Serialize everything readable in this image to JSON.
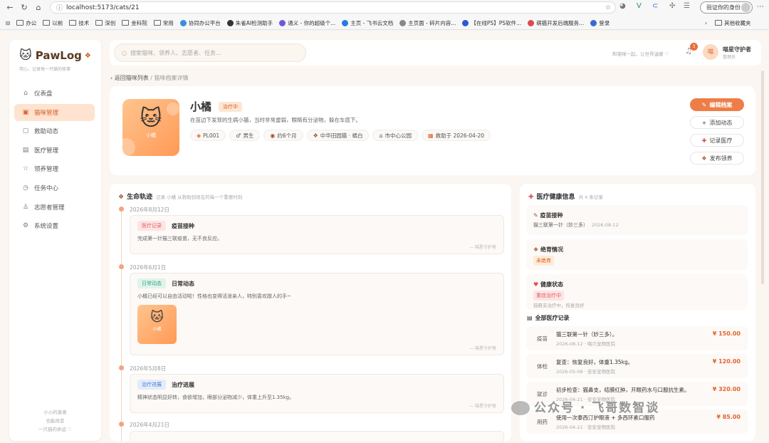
{
  "browser": {
    "url": "localhost:5173/cats/21",
    "identity": "验证你的身份",
    "bookmarks": [
      "办公",
      "以前",
      "技术",
      "深创",
      "金科院",
      "常用",
      "协同办公平台",
      "朱雀AI检测助手",
      "通义 - 你的超级个...",
      "主页 - 飞书云文档",
      "主页面 - 碎片内容...",
      "【在线PS】PS软件...",
      "萌猫开发后端服务...",
      "登录",
      "其他收藏夹"
    ]
  },
  "app": {
    "name": "PawLog",
    "tagline": "用心，记录每一只猫的故事",
    "nav": [
      {
        "label": "仪表盘",
        "icon": "home-icon",
        "glyph": "⌂"
      },
      {
        "label": "猫咪管理",
        "icon": "cat-icon",
        "glyph": "▣",
        "active": true
      },
      {
        "label": "救助动态",
        "icon": "rescue-icon",
        "glyph": "▢"
      },
      {
        "label": "医疗管理",
        "icon": "medical-icon",
        "glyph": "▤"
      },
      {
        "label": "领养管理",
        "icon": "star-icon",
        "glyph": "☆"
      },
      {
        "label": "任务中心",
        "icon": "clock-icon",
        "glyph": "◷"
      },
      {
        "label": "志愿者管理",
        "icon": "user-icon",
        "glyph": "♙"
      },
      {
        "label": "系统设置",
        "icon": "gear-icon",
        "glyph": "⚙"
      }
    ],
    "footer": [
      "小小的善意",
      "也能改变",
      "一只猫的命运 ♡"
    ]
  },
  "topbar": {
    "search_placeholder": "搜索猫咪、领养人、志愿者、任务...",
    "motto": "和猫咪一起，让世界温暖 ♡",
    "notifications": "3",
    "avatar_text": "喵",
    "user_name": "喵星守护者",
    "user_role": "管理员"
  },
  "breadcrumb": {
    "back": "‹ 返回猫咪列表",
    "sep": "/",
    "current": "猫咪档案详情"
  },
  "cat": {
    "name": "小橘",
    "status": "治疗中",
    "description": "在苗边下发现的生病小猫，当时非常虚弱，眼睛有分泌物，躲在车底下。",
    "chips": [
      {
        "icon": "tag-icon",
        "glyph": "◈",
        "label": "PL001"
      },
      {
        "icon": "male-icon",
        "glyph": "♂",
        "label": "男生"
      },
      {
        "icon": "cake-icon",
        "glyph": "◉",
        "label": "约6个月"
      },
      {
        "icon": "paw-icon",
        "glyph": "❖",
        "label": "中华田园猫 · 橘白"
      },
      {
        "icon": "location-icon",
        "glyph": "⌂",
        "label": "市中心公园"
      },
      {
        "icon": "calendar-icon",
        "glyph": "▦",
        "label": "救助于 2026-04-20"
      }
    ],
    "actions": [
      {
        "label": "编辑档案",
        "glyph": "✎"
      },
      {
        "label": "添加动态",
        "glyph": "+"
      },
      {
        "label": "记录医疗",
        "glyph": "✚"
      },
      {
        "label": "发布领养",
        "glyph": "❖"
      }
    ]
  },
  "timeline": {
    "title": "生命轨迹",
    "subtitle": "记录 小橘 从救助到现在的每一个重要时刻",
    "events": [
      {
        "date": "2026年8月12日",
        "tag": "医疗记录",
        "title": "疫苗接种",
        "text": "完成第一针猫三联疫苗，无不良反应。",
        "by": "— 喵星守护者",
        "tag_bg": "#fde4e4",
        "tag_color": "#e06060"
      },
      {
        "date": "2026年6月1日",
        "tag": "日常动态",
        "title": "日常动态",
        "text": "小橘已经可以自由活动啦！性格也变得活泼亲人，特别喜欢蹭人的手~",
        "by": "— 喵星守护者",
        "tag_bg": "#dff4ec",
        "tag_color": "#3aa57a",
        "photo_label": "小橘"
      },
      {
        "date": "2026年5月8日",
        "tag": "治疗进展",
        "title": "治疗进展",
        "text": "精神状态明显好转，食欲增加，眼部分泌物减少，体重上升至1.35kg。",
        "by": "— 喵星守护者",
        "tag_bg": "#e3ecfb",
        "tag_color": "#4a7bd0"
      },
      {
        "date": "2026年4月21日"
      }
    ]
  },
  "health": {
    "title": "医疗健康信息",
    "count": "共 4 条记录",
    "vaccine": {
      "label": "疫苗接种",
      "value": "猫三联第一针（妙三多）",
      "date": "2026-08-12"
    },
    "neuter": {
      "label": "绝育情况",
      "value": "未绝育"
    },
    "status": {
      "label": "健康状态",
      "value": "重症治疗中",
      "note": "猫藓支治疗中，恢复良好"
    },
    "records_title": "全部医疗记录",
    "records": [
      {
        "type": "疫苗",
        "desc": "猫三联第一针（妙三多）。",
        "meta": "2026-08-12 · 喵爪宠物医院",
        "amount": "¥ 150.00"
      },
      {
        "type": "体检",
        "desc": "复查：恢复良好，体重1.35kg。",
        "meta": "2026-05-08 · 安安宠物医院",
        "amount": "¥ 120.00"
      },
      {
        "type": "就诊",
        "desc": "初步检查：猫鼻支，结膜红肿，开眼药水与口服抗生素。",
        "meta": "2026-04-21 · 安安宠物医院",
        "amount": "¥ 320.00"
      },
      {
        "type": "用药",
        "desc": "使用一次泰西汀护眼液 + 多西环素口服药",
        "meta": "2026-04-21 · 安安宠物医院",
        "amount": "¥ 85.00"
      }
    ]
  },
  "watermark": "公众号 · 飞哥数智谈"
}
